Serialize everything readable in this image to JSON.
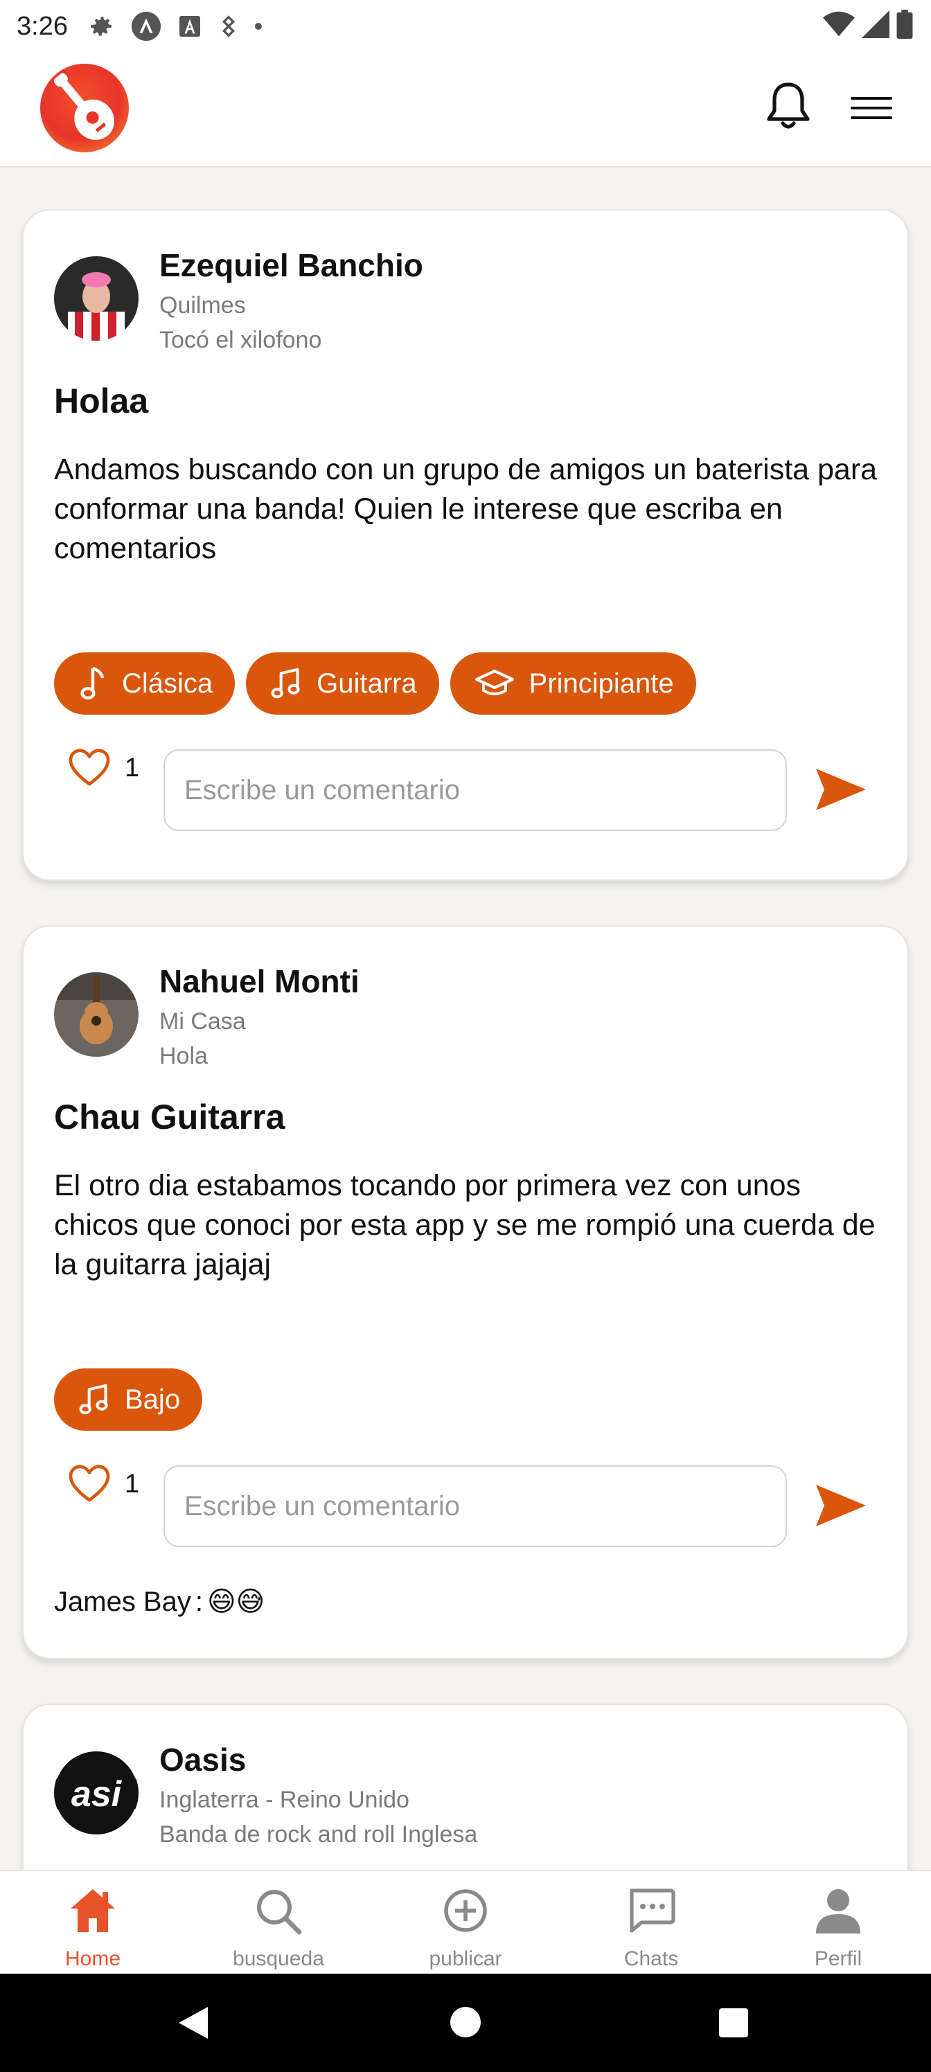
{
  "status_bar": {
    "time": "3:26",
    "left_icons": [
      "gear-icon",
      "android-auto-icon",
      "font-a-icon",
      "data-saver-icon",
      "dot-icon"
    ],
    "right_icons": [
      "wifi-icon",
      "signal-icon",
      "battery-icon"
    ]
  },
  "app_bar": {
    "logo": "guitar-logo",
    "notification_icon": "bell-icon",
    "menu_icon": "hamburger-menu-icon"
  },
  "colors": {
    "accent": "#d9560b",
    "nav_active": "#e8542a",
    "text_muted": "#7a7a7a",
    "background": "#f4f3f1"
  },
  "posts": [
    {
      "author": "Ezequiel Banchio",
      "location": "Quilmes",
      "activity": "Tocó el xilofono",
      "title": "Holaa",
      "body": "Andamos buscando con un grupo de amigos un baterista para conformar una banda! Quien le interese que escriba en comentarios",
      "tags": [
        {
          "label": "Clásica",
          "icon": "music-note-icon"
        },
        {
          "label": "Guitarra",
          "icon": "music-notes-icon"
        },
        {
          "label": "Principiante",
          "icon": "graduation-cap-icon"
        }
      ],
      "likes": "1",
      "comment_placeholder": "Escribe un comentario",
      "comments": []
    },
    {
      "author": "Nahuel Monti",
      "location": "Mi Casa",
      "activity": "Hola",
      "title": "Chau Guitarra",
      "body": "El otro dia estabamos tocando por primera vez con unos chicos que conoci por esta app y se me rompió una cuerda de la guitarra jajajaj",
      "tags": [
        {
          "label": "Bajo",
          "icon": "music-notes-icon"
        }
      ],
      "likes": "1",
      "comment_placeholder": "Escribe un comentario",
      "comments": [
        {
          "author": "James Bay",
          "text": "😄😅"
        }
      ]
    },
    {
      "author": "Oasis",
      "location": "Inglaterra - Reino Unido",
      "activity": "Banda de rock and roll Inglesa"
    }
  ],
  "bottom_nav": [
    {
      "label": "Home",
      "icon": "home-icon",
      "active": true
    },
    {
      "label": "busqueda",
      "icon": "search-icon",
      "active": false
    },
    {
      "label": "publicar",
      "icon": "add-circle-icon",
      "active": false
    },
    {
      "label": "Chats",
      "icon": "chat-icon",
      "active": false
    },
    {
      "label": "Perfil",
      "icon": "person-icon",
      "active": false
    }
  ],
  "system_nav": [
    "back-icon",
    "home-circle-icon",
    "recents-icon"
  ]
}
